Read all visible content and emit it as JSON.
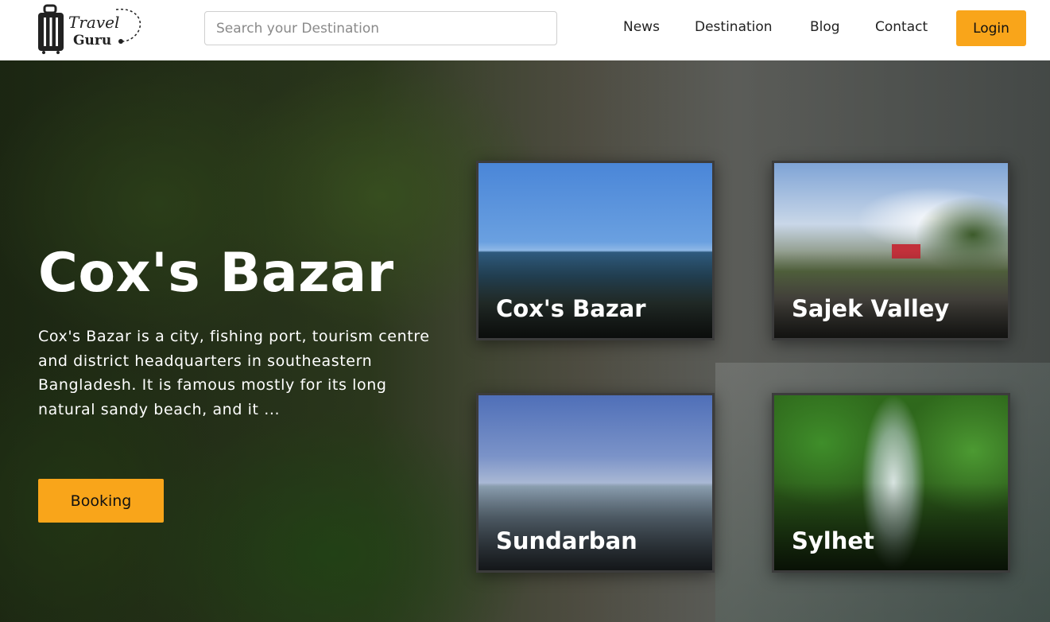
{
  "header": {
    "logo_line1": "Travel",
    "logo_line2": "Guru",
    "search_placeholder": "Search your Destination",
    "nav": [
      "News",
      "Destination",
      "Blog",
      "Contact"
    ],
    "login_label": "Login"
  },
  "hero": {
    "title": "Cox's Bazar",
    "description": "Cox's Bazar is a city, fishing port, tourism centre and district headquarters in southeastern Bangladesh. It is famous mostly for its long natural sandy beach, and it ...",
    "booking_label": "Booking"
  },
  "cards": [
    {
      "label": "Cox's Bazar"
    },
    {
      "label": "Sajek Valley"
    },
    {
      "label": "Sundarban"
    },
    {
      "label": "Sylhet"
    }
  ],
  "colors": {
    "accent": "#f9a51a"
  }
}
